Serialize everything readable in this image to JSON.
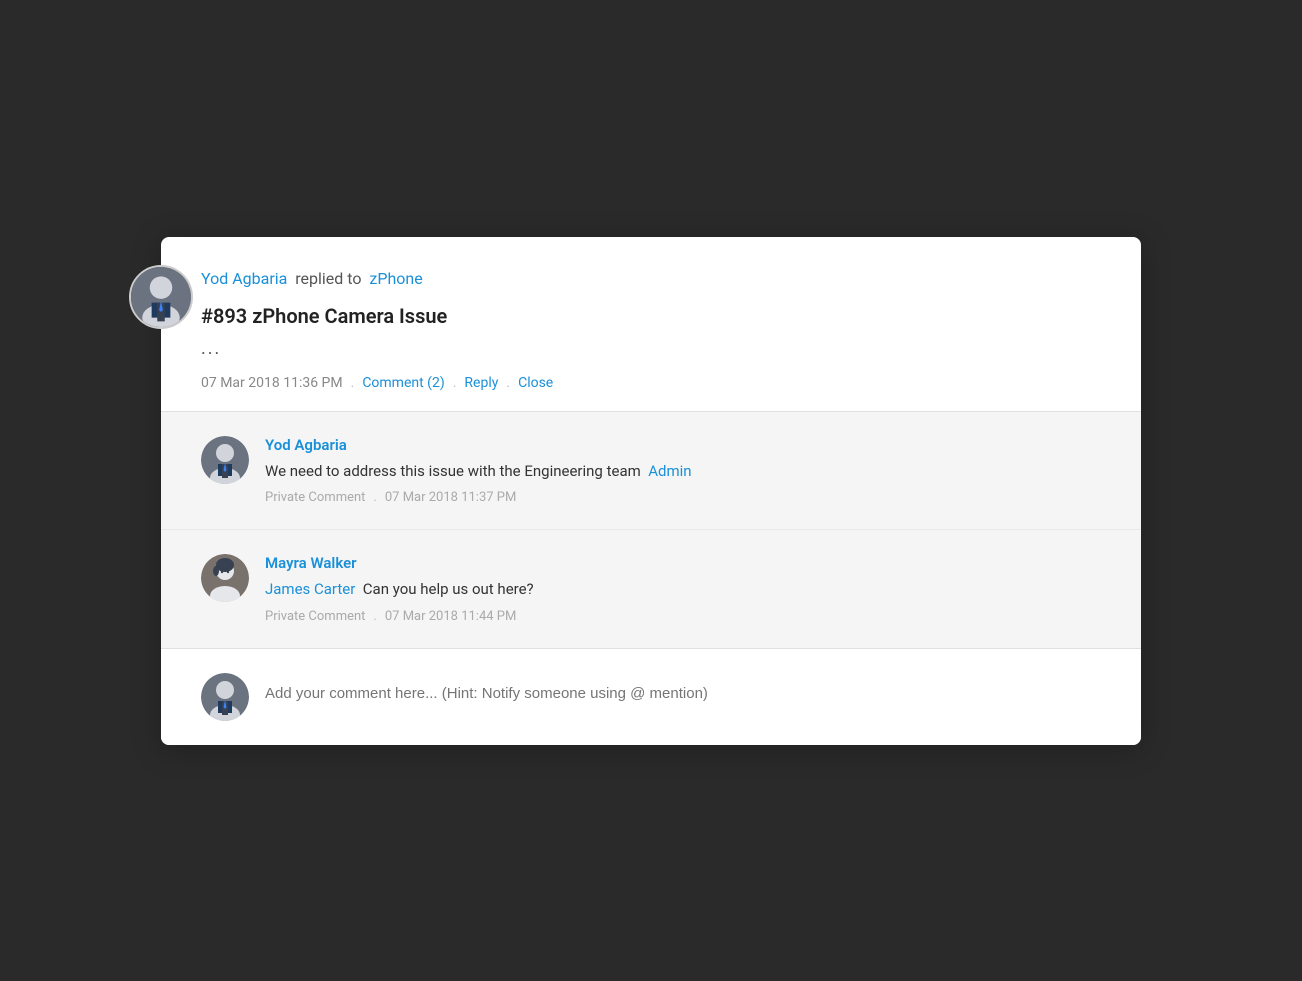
{
  "colors": {
    "link_blue": "#1a90d9",
    "text_dark": "#222",
    "text_gray": "#888",
    "text_meta": "#aaa",
    "bg_white": "#ffffff",
    "bg_light": "#f5f5f5",
    "admin_blue": "#1a90d9"
  },
  "outer_avatar": {
    "alt": "Yod Agbaria avatar"
  },
  "header": {
    "replied_prefix": "replied to",
    "user_name": "Yod Agbaria",
    "replied_to": "zPhone",
    "ticket_title": "#893 zPhone Camera Issue",
    "ellipsis": "...",
    "timestamp": "07 Mar 2018 11:36 PM",
    "comment_label": "Comment (2)",
    "reply_label": "Reply",
    "close_label": "Close",
    "dot1": ".",
    "dot2": ".",
    "dot3": "."
  },
  "comments": [
    {
      "id": 1,
      "commenter_name": "Yod Agbaria",
      "comment_prefix": "We need to address this issue with the Engineering team",
      "comment_mention": "Admin",
      "privacy_label": "Private Comment",
      "dot": ".",
      "timestamp": "07 Mar 2018 11:37 PM",
      "avatar_type": "yod"
    },
    {
      "id": 2,
      "commenter_name": "Mayra Walker",
      "comment_mention": "James Carter",
      "comment_suffix": "Can you help us out here?",
      "privacy_label": "Private Comment",
      "dot": ".",
      "timestamp": "07 Mar 2018 11:44 PM",
      "avatar_type": "mayra"
    }
  ],
  "input": {
    "placeholder": "Add your comment here... (Hint: Notify someone using @ mention)",
    "avatar_type": "yod"
  }
}
